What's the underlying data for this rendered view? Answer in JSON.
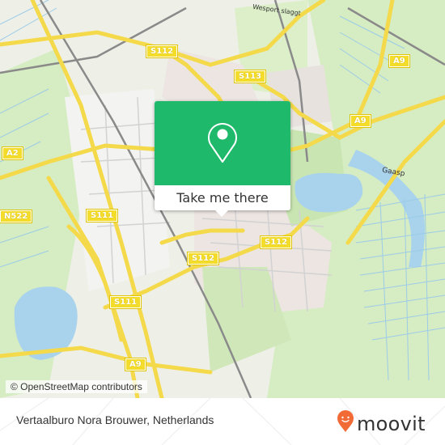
{
  "map": {
    "road_labels": [
      {
        "id": "s112-top",
        "text": "S112"
      },
      {
        "id": "s113",
        "text": "S113"
      },
      {
        "id": "a9-top",
        "text": "A9"
      },
      {
        "id": "a9-mid",
        "text": "A9"
      },
      {
        "id": "a2",
        "text": "A2"
      },
      {
        "id": "n522",
        "text": "N522"
      },
      {
        "id": "s111-mid",
        "text": "S111"
      },
      {
        "id": "s112-right",
        "text": "S112"
      },
      {
        "id": "s112-center",
        "text": "S112"
      },
      {
        "id": "s111-bottom",
        "text": "S111"
      },
      {
        "id": "a9-bottom",
        "text": "A9"
      }
    ],
    "place_labels": [
      {
        "id": "gaasp",
        "text": "Gaasp"
      },
      {
        "id": "street-top",
        "text": "Wesport slaggt"
      }
    ],
    "attribution": "© OpenStreetMap contributors"
  },
  "popup": {
    "icon": "map-pin-icon",
    "cta_label": "Take me there",
    "accent_color": "#1eb96b"
  },
  "footer": {
    "location_title": "Vertaalburo Nora Brouwer, Netherlands",
    "brand_name": "moovit",
    "brand_color": "#f26a36"
  }
}
